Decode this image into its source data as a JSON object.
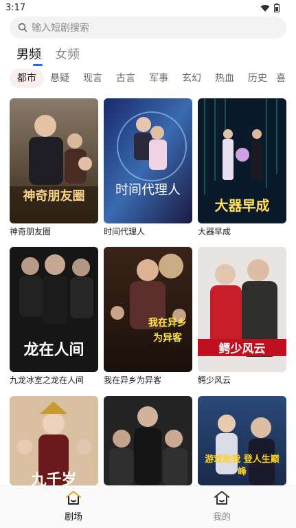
{
  "status": {
    "time": "3:17"
  },
  "search": {
    "placeholder": "输入短剧搜索"
  },
  "gender_tabs": [
    {
      "label": "男频",
      "active": true
    },
    {
      "label": "女频",
      "active": false
    }
  ],
  "categories": [
    "都市",
    "悬疑",
    "现言",
    "古言",
    "军事",
    "玄幻",
    "热血",
    "历史",
    "喜"
  ],
  "dramas": [
    {
      "title": "神奇朋友圈",
      "poster_text": "神奇朋友圈"
    },
    {
      "title": "时间代理人",
      "poster_text": "时间代理人"
    },
    {
      "title": "大器早成",
      "poster_text": "大器早成"
    },
    {
      "title": "九龙冰室之龙在人间",
      "poster_text": "龙在人间"
    },
    {
      "title": "我在异乡为异客",
      "poster_text": "我在异乡为异客"
    },
    {
      "title": "鳄少风云",
      "poster_text": "鳄少风云"
    },
    {
      "title": "",
      "poster_text": "九千岁"
    },
    {
      "title": "",
      "poster_text": ""
    },
    {
      "title": "",
      "poster_text": "游戏助我 登人生巅峰"
    }
  ],
  "bottom_nav": [
    {
      "label": "剧场",
      "icon": "home-icon",
      "active": true
    },
    {
      "label": "我的",
      "icon": "home-icon",
      "active": false
    }
  ],
  "colors": {
    "accent": "#1a6cff",
    "category_active_bg": "#fdeeee",
    "active_nav_icon": "#e8a020"
  }
}
